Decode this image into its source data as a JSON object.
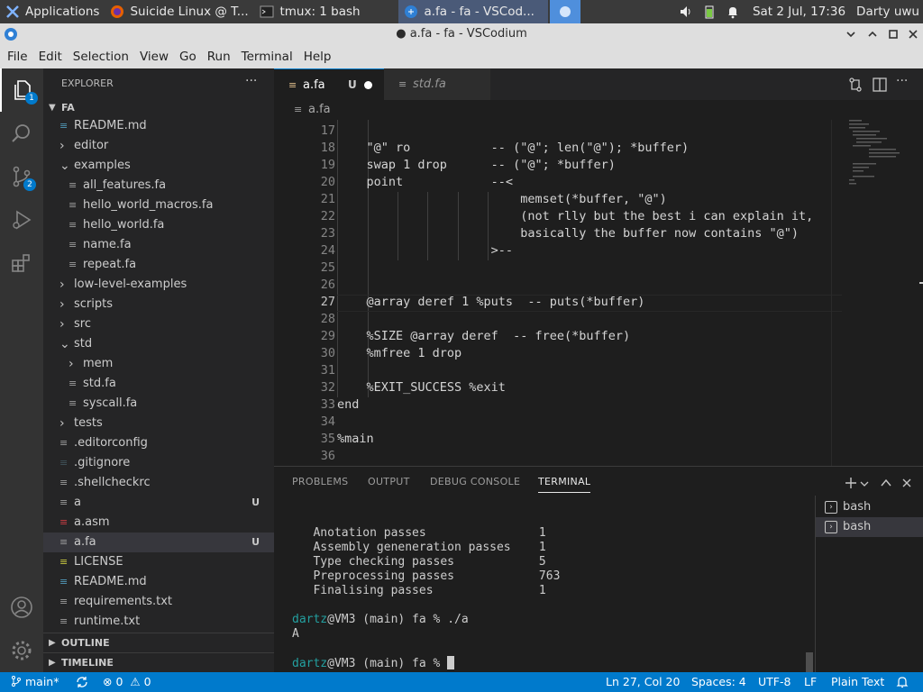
{
  "desktop_panel": {
    "applications": "Applications",
    "tasks": [
      "Suicide Linux @ T...",
      "tmux: 1 bash",
      "a.fa - fa - VSCod..."
    ],
    "clock": "Sat  2 Jul, 17:36",
    "user": "Darty uwu"
  },
  "window": {
    "title": "● a.fa - fa - VSCodium",
    "menu": [
      "File",
      "Edit",
      "Selection",
      "View",
      "Go",
      "Run",
      "Terminal",
      "Help"
    ]
  },
  "activity_bar": {
    "explorer_badge": "1",
    "scm_badge": "2"
  },
  "sidebar": {
    "title": "EXPLORER",
    "more": "···",
    "root": "FA",
    "items": [
      {
        "label": "README.md",
        "git": ""
      },
      {
        "label": "editor",
        "git": ""
      },
      {
        "label": "examples",
        "git": ""
      },
      {
        "label": "all_features.fa",
        "git": ""
      },
      {
        "label": "hello_world_macros.fa",
        "git": ""
      },
      {
        "label": "hello_world.fa",
        "git": ""
      },
      {
        "label": "name.fa",
        "git": ""
      },
      {
        "label": "repeat.fa",
        "git": ""
      },
      {
        "label": "low-level-examples",
        "git": ""
      },
      {
        "label": "scripts",
        "git": ""
      },
      {
        "label": "src",
        "git": ""
      },
      {
        "label": "std",
        "git": ""
      },
      {
        "label": "mem",
        "git": ""
      },
      {
        "label": "std.fa",
        "git": ""
      },
      {
        "label": "syscall.fa",
        "git": ""
      },
      {
        "label": "tests",
        "git": ""
      },
      {
        "label": ".editorconfig",
        "git": ""
      },
      {
        "label": ".gitignore",
        "git": ""
      },
      {
        "label": ".shellcheckrc",
        "git": ""
      },
      {
        "label": "a",
        "git": "U"
      },
      {
        "label": "a.asm",
        "git": ""
      },
      {
        "label": "a.fa",
        "git": "U"
      },
      {
        "label": "LICENSE",
        "git": ""
      },
      {
        "label": "README.md",
        "git": ""
      },
      {
        "label": "requirements.txt",
        "git": ""
      },
      {
        "label": "runtime.txt",
        "git": ""
      }
    ],
    "outline": "OUTLINE",
    "timeline": "TIMELINE"
  },
  "tabs": [
    {
      "label": "a.fa",
      "status": "U"
    },
    {
      "label": "std.fa",
      "status": ""
    }
  ],
  "breadcrumb": "a.fa",
  "editor": {
    "lines": [
      {
        "n": "17",
        "text": ""
      },
      {
        "n": "18",
        "text": "    \"@\" ro           -- (\"@\"; len(\"@\"); *buffer)"
      },
      {
        "n": "19",
        "text": "    swap 1 drop      -- (\"@\"; *buffer)"
      },
      {
        "n": "20",
        "text": "    point            --<"
      },
      {
        "n": "21",
        "text": "                         memset(*buffer, \"@\")"
      },
      {
        "n": "22",
        "text": "                         (not rlly but the best i can explain it,"
      },
      {
        "n": "23",
        "text": "                         basically the buffer now contains \"@\")"
      },
      {
        "n": "24",
        "text": "                     >--"
      },
      {
        "n": "25",
        "text": ""
      },
      {
        "n": "26",
        "text": ""
      },
      {
        "n": "27",
        "text": "    @array deref 1 %puts  -- puts(*buffer)"
      },
      {
        "n": "28",
        "text": ""
      },
      {
        "n": "29",
        "text": "    %SIZE @array deref  -- free(*buffer)"
      },
      {
        "n": "30",
        "text": "    %mfree 1 drop"
      },
      {
        "n": "31",
        "text": ""
      },
      {
        "n": "32",
        "text": "    %EXIT_SUCCESS %exit"
      },
      {
        "n": "33",
        "text": "end"
      },
      {
        "n": "34",
        "text": ""
      },
      {
        "n": "35",
        "text": "%main"
      },
      {
        "n": "36",
        "text": ""
      }
    ]
  },
  "panel": {
    "tabs": [
      "PROBLEMS",
      "OUTPUT",
      "DEBUG CONSOLE",
      "TERMINAL"
    ],
    "terminal_lines": [
      {
        "user": "",
        "text": "   Anotation passes                1"
      },
      {
        "user": "",
        "text": "   Assembly geneneration passes    1"
      },
      {
        "user": "",
        "text": "   Type checking passes            5"
      },
      {
        "user": "",
        "text": "   Preprocessing passes            763"
      },
      {
        "user": "",
        "text": "   Finalising passes               1"
      },
      {
        "user": "",
        "text": ""
      },
      {
        "user": "dartz",
        "text": "@VM3 (main) fa % ./a"
      },
      {
        "user": "",
        "text": "A"
      },
      {
        "user": "",
        "text": ""
      },
      {
        "user": "dartz",
        "text": "@VM3 (main) fa % "
      }
    ],
    "terminals": [
      "bash",
      "bash"
    ]
  },
  "status_bar": {
    "branch": "main*",
    "errors": "0",
    "warnings": "0",
    "position": "Ln 27, Col 20",
    "spaces": "Spaces: 4",
    "encoding": "UTF-8",
    "eol": "LF",
    "language": "Plain Text"
  },
  "colors": {
    "accent": "#007acc",
    "terminal_user": "#23a0a0"
  }
}
